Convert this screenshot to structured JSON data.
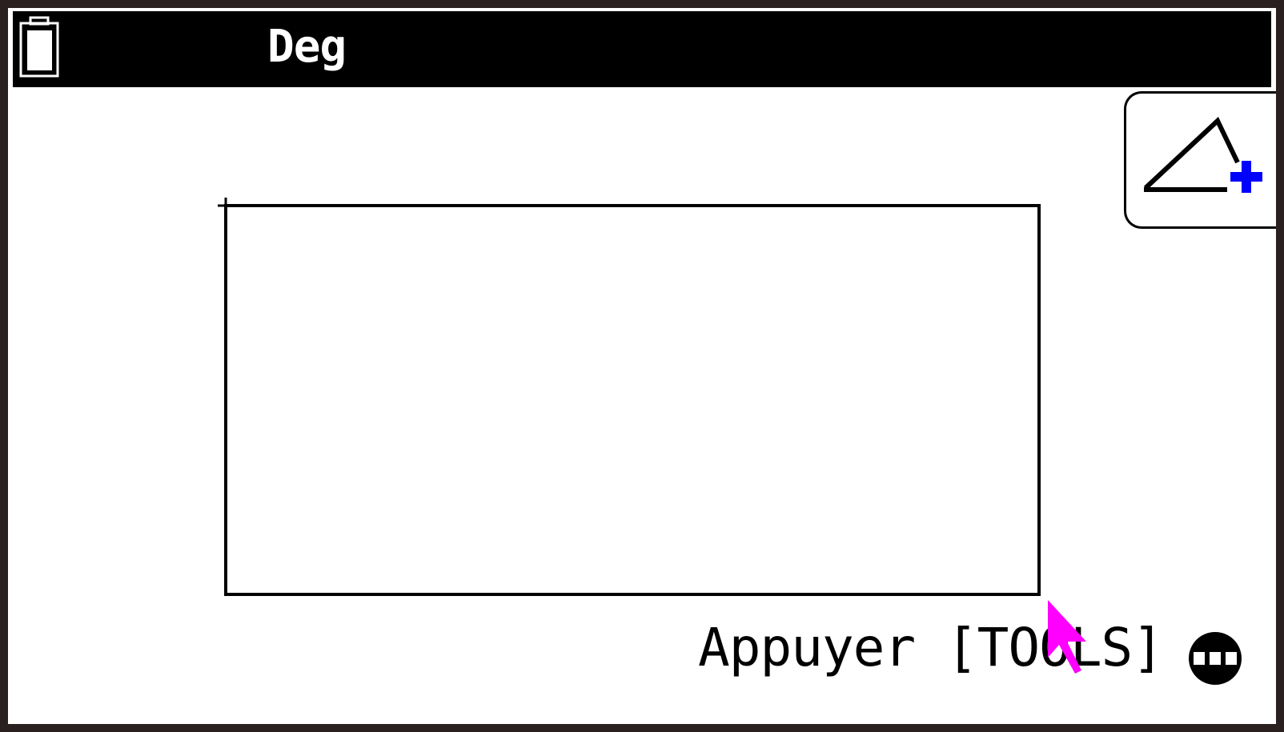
{
  "status_bar": {
    "angle_mode": "Deg",
    "battery_icon": "battery-icon"
  },
  "toolbar": {
    "add_shape_icon": "triangle-plus-icon",
    "accent_color": "#0000ff"
  },
  "footer": {
    "hint": "Appuyer [TOOLS]",
    "more_icon": "more-icon"
  },
  "cursor": {
    "icon": "pointer-cursor-icon",
    "color": "#ff00ff"
  }
}
